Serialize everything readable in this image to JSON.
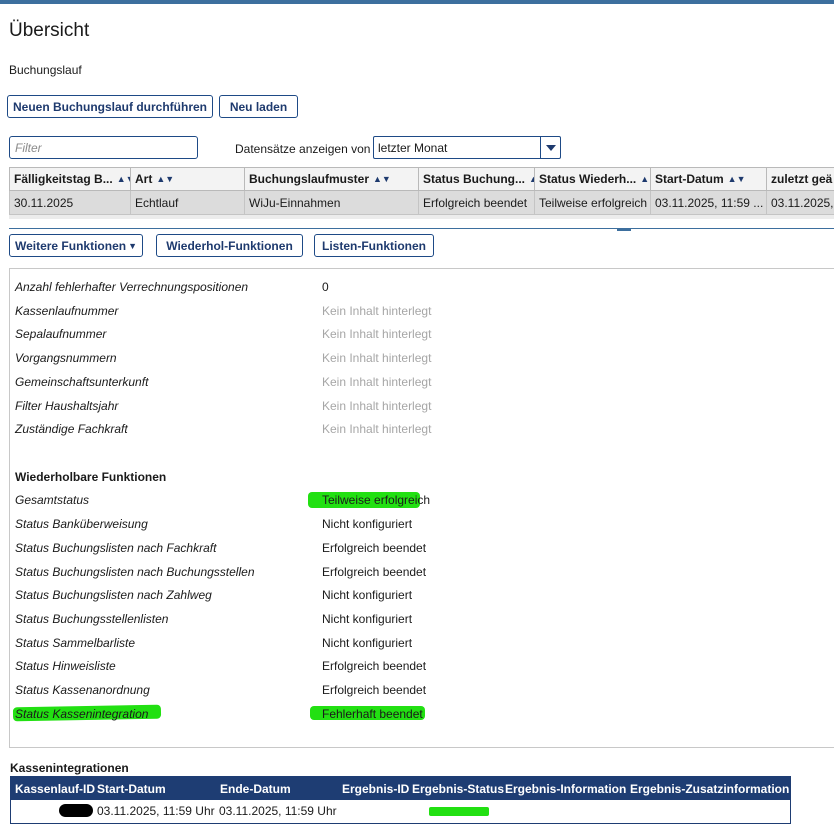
{
  "page": {
    "title": "Übersicht",
    "subtitle": "Buchungslauf"
  },
  "actions": {
    "new_run": "Neuen Buchungslauf durchführen",
    "reload": "Neu laden"
  },
  "filter": {
    "placeholder": "Filter",
    "records_label": "Datensätze anzeigen von",
    "records_value": "letzter Monat"
  },
  "grid": {
    "columns": [
      "Fälligkeitstag B...",
      "Art",
      "Buchungslaufmuster",
      "Status Buchung...",
      "Status Wiederh...",
      "Start-Datum",
      "zuletzt geä"
    ],
    "rows": [
      [
        "30.11.2025",
        "Echtlauf",
        "WiJu-Einnahmen",
        "Erfolgreich beendet",
        "Teilweise erfolgreich",
        "03.11.2025, 11:59 ...",
        "03.11.2025,"
      ]
    ]
  },
  "toolbar": {
    "more": "Weitere Funktionen",
    "repeat": "Wiederhol-Funktionen",
    "lists": "Listen-Funktionen"
  },
  "details": {
    "fields": [
      {
        "label": "Anzahl fehlerhafter Verrechnungspositionen",
        "value": "0"
      },
      {
        "label": "Kassenlaufnummer",
        "value": "Kein Inhalt hinterlegt"
      },
      {
        "label": "Sepalaufnummer",
        "value": "Kein Inhalt hinterlegt"
      },
      {
        "label": "Vorgangsnummern",
        "value": "Kein Inhalt hinterlegt"
      },
      {
        "label": "Gemeinschaftsunterkunft",
        "value": "Kein Inhalt hinterlegt"
      },
      {
        "label": "Filter Haushaltsjahr",
        "value": "Kein Inhalt hinterlegt"
      },
      {
        "label": "Zuständige Fachkraft",
        "value": "Kein Inhalt hinterlegt"
      }
    ],
    "repeat_heading": "Wiederholbare Funktionen",
    "repeat_fields": [
      {
        "label": "Gesamtstatus",
        "value": "Teilweise erfolgreich"
      },
      {
        "label": "Status Banküberweisung",
        "value": "Nicht konfiguriert"
      },
      {
        "label": "Status Buchungslisten nach Fachkraft",
        "value": "Erfolgreich beendet"
      },
      {
        "label": "Status Buchungslisten nach Buchungsstellen",
        "value": "Erfolgreich beendet"
      },
      {
        "label": "Status Buchungslisten nach Zahlweg",
        "value": "Nicht konfiguriert"
      },
      {
        "label": "Status Buchungsstellenlisten",
        "value": "Nicht konfiguriert"
      },
      {
        "label": "Status Sammelbarliste",
        "value": "Nicht konfiguriert"
      },
      {
        "label": "Status Hinweisliste",
        "value": "Erfolgreich beendet"
      },
      {
        "label": "Status Kassenanordnung",
        "value": "Erfolgreich beendet"
      },
      {
        "label": "Status Kassenintegration",
        "value": "Fehlerhaft beendet"
      }
    ]
  },
  "kassen": {
    "title": "Kassenintegrationen",
    "columns": [
      "Kassenlauf-ID",
      "Start-Datum",
      "Ende-Datum",
      "Ergebnis-ID",
      "Ergebnis-Status",
      "Ergebnis-Information",
      "Ergebnis-Zusatzinformation"
    ],
    "row": {
      "start": "03.11.2025, 11:59 Uhr",
      "end": "03.11.2025, 11:59 Uhr"
    }
  },
  "colors": {
    "accent": "#1e3d73",
    "highlight": "#22e012",
    "topbar": "#3d6f9e"
  },
  "icons": {
    "sort": "sort-icon",
    "dropdown": "chevron-down-icon"
  }
}
